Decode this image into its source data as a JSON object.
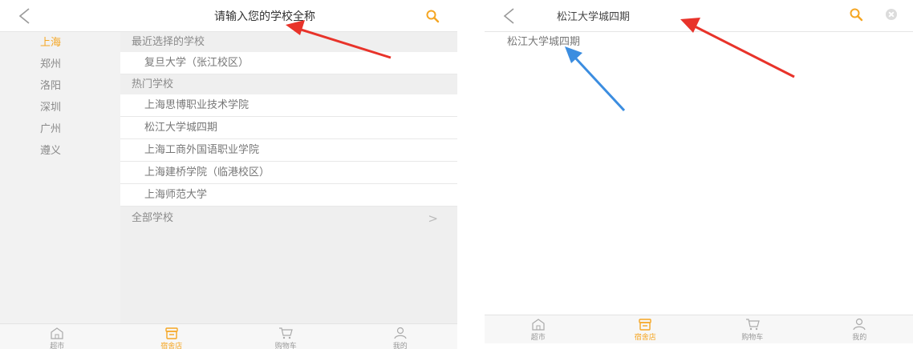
{
  "colors": {
    "accent": "#f5a623",
    "annotation_red": "#e8332a",
    "annotation_blue": "#3b8de0"
  },
  "screen1": {
    "title": "请输入您的学校全称",
    "cities": [
      "上海",
      "郑州",
      "洛阳",
      "深圳",
      "广州",
      "遵义"
    ],
    "recent_header": "最近选择的学校",
    "recent_items": [
      "复旦大学（张江校区）"
    ],
    "hot_header": "热门学校",
    "hot_items": [
      "上海思博职业技术学院",
      "松江大学城四期",
      "上海工商外国语职业学院",
      "上海建桥学院（临港校区）",
      "上海师范大学"
    ],
    "all_schools": "全部学校",
    "all_chevron": ">"
  },
  "screen2": {
    "query": "松江大学城四期",
    "results": [
      "松江大学城四期"
    ]
  },
  "tabs": [
    "超市",
    "宿舍店",
    "购物车",
    "我的"
  ],
  "icons": {
    "back": "chevron-left-icon",
    "search": "search-icon",
    "clear": "clear-icon",
    "home": "home-icon",
    "store": "store-icon",
    "cart": "cart-icon",
    "profile": "profile-icon"
  }
}
